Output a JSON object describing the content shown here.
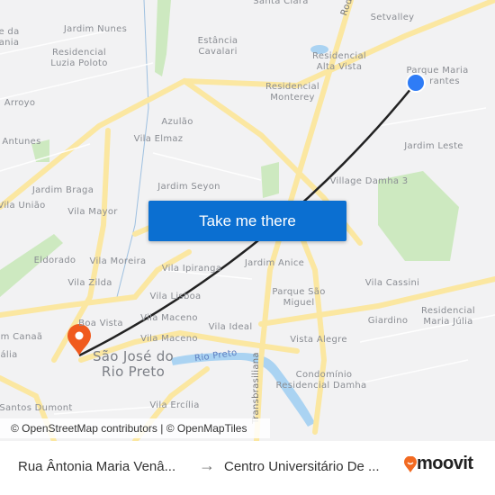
{
  "map": {
    "labels": [
      "Santa Clara",
      "Setvalley",
      "e da",
      "ania",
      "Jardim Nunes",
      "Estância",
      "Cavalari",
      "Residencial",
      "Luzia Poloto",
      "Residencial",
      "Alta Vista",
      "Parque Maria",
      "rantes",
      "Residencial",
      "Monterey",
      "Arroyo",
      "Azulão",
      "Vila Elmaz",
      "Antunes",
      "Jardim Leste",
      "Jardim Braga",
      "Jardim Seyon",
      "Village Damha 3",
      "Vila União",
      "Vila Mayor",
      "Eldorado",
      "Vila Moreira",
      "Vila Ipiranga",
      "Jardim Anice",
      "Vila Cassini",
      "Vila Zilda",
      "Vila Lisboa",
      "Parque São",
      "Miguel",
      "Residencial",
      "Maria Júlia",
      "Giardino",
      "Boa Vista",
      "Vila Maceno",
      "Vila Ideal",
      "m Canaã",
      "Vila Maceno",
      "Vista Alegre",
      "ália",
      "Condomínio",
      "Residencial Damha",
      "Vila Ercília",
      "Santos Dumont"
    ],
    "city_label": [
      "São José do",
      "Rio Preto"
    ],
    "river_label": "Rio Preto",
    "road_labels": [
      "Transbrasiliana",
      "Rod"
    ],
    "colors": {
      "road": "#fbe7a1",
      "land": "#f2f2f3",
      "park": "#cde9c0",
      "water": "#aad3f2",
      "route": "#222222",
      "origin": "#2e7cf6",
      "destination": "#f05a1e"
    },
    "origin_icon": "origin-dot-icon",
    "destination_icon": "destination-pin-icon"
  },
  "cta": {
    "label": "Take me there"
  },
  "attribution": "© OpenStreetMap contributors | © OpenMapTiles",
  "footer": {
    "from": "Rua Ântonia Maria Venâ...",
    "arrow": "→",
    "to": "Centro Universitário De ...",
    "logo": "moovit",
    "brand_color": "#f26a21"
  }
}
